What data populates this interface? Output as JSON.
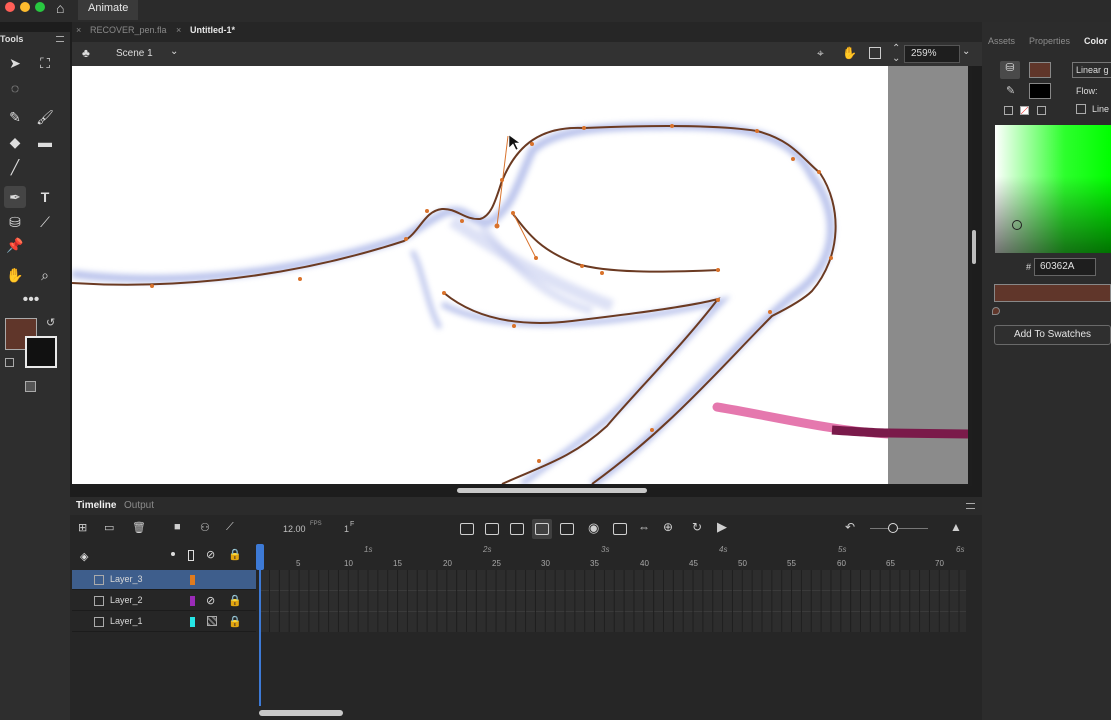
{
  "titlebar": {
    "app_tab": "Animate"
  },
  "doc_tabs": [
    {
      "label": "RECOVER_pen.fla"
    },
    {
      "label": "Untitled-1*"
    }
  ],
  "tools": {
    "header": "Tools"
  },
  "scene": {
    "label": "Scene 1",
    "zoom": "259%"
  },
  "right_panel": {
    "tabs": [
      {
        "label": "Assets"
      },
      {
        "label": "Properties"
      },
      {
        "label": "Color"
      }
    ],
    "fill_type": "Linear g",
    "flow_label": "Flow:",
    "line_label": "Line",
    "hex_prefix": "#",
    "hex_value": "60362A",
    "add_swatch": "Add To Swatches"
  },
  "colors": {
    "fill": "#60362A",
    "stroke": "#000000",
    "outline": "#6b3a22",
    "anchor": "#d9722b",
    "glow": "#8f9ee0",
    "pink": "#e060a0"
  },
  "timeline": {
    "tabs": [
      {
        "label": "Timeline"
      },
      {
        "label": "Output"
      }
    ],
    "fps": "12.00",
    "fps_unit": "FPS",
    "frame": "1",
    "frame_unit": "F",
    "seconds": [
      "1s",
      "2s",
      "3s",
      "4s",
      "5s",
      "6s"
    ],
    "frame_numbers": [
      "5",
      "10",
      "15",
      "20",
      "25",
      "30",
      "35",
      "40",
      "45",
      "50",
      "55",
      "60",
      "65",
      "70"
    ],
    "layers": [
      {
        "name": "Layer_3",
        "color": "#e07b1e",
        "selected": true
      },
      {
        "name": "Layer_2",
        "color": "#9b2bb8",
        "selected": false
      },
      {
        "name": "Layer_1",
        "color": "#25e6e6",
        "selected": false
      }
    ]
  }
}
